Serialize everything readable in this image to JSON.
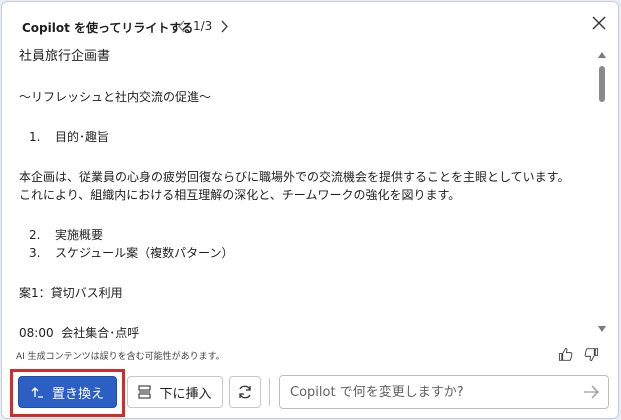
{
  "header": {
    "title": "Copilot を使ってリライトする",
    "page_indicator": "1/3",
    "prev_icon": "chevron-left-icon",
    "next_icon": "chevron-right-icon",
    "close_icon": "close-icon"
  },
  "content": {
    "doc_title": "社員旅行企画書",
    "subtitle": "〜リフレッシュと社内交流の促進〜",
    "section1": {
      "num": "1.",
      "label": "目的･趣旨"
    },
    "body_line1": "本企画は、従業員の心身の疲労回復ならびに職場外での交流機会を提供することを主眼としています。",
    "body_line2": "これにより、組織内における相互理解の深化と、チームワークの強化を図ります。",
    "section2": {
      "num": "2.",
      "label": "実施概要"
    },
    "section3": {
      "num": "3.",
      "label": "スケジュール案（複数パターン）"
    },
    "plan1": "案1：貸切バス利用",
    "schedule_time": "08:00",
    "schedule_event": "会社集合･点呼"
  },
  "footer": {
    "disclaimer": "AI 生成コンテンツは誤りを含む可能性があります。",
    "like_icon": "thumbs-up-icon",
    "dislike_icon": "thumbs-down-icon"
  },
  "toolbar": {
    "replace_label": "置き換え",
    "insert_label": "下に挿入",
    "regenerate_icon": "refresh-icon",
    "prompt_placeholder": "Copilot で何を変更しますか?",
    "prompt_value": "",
    "send_icon": "send-arrow-icon"
  },
  "colors": {
    "primary_button": "#2b5fc4",
    "highlight_border": "#d42a2a"
  }
}
